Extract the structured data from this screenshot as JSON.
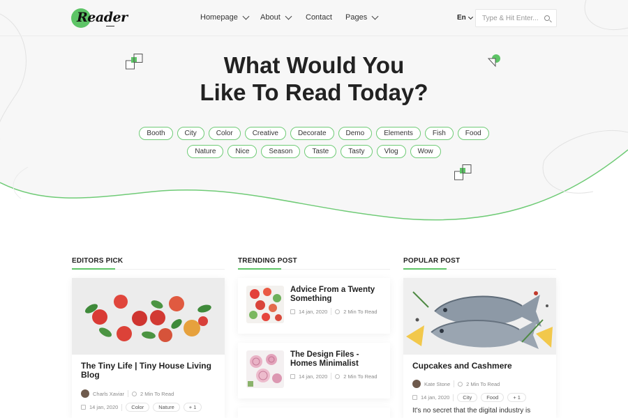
{
  "header": {
    "logo_text": "Reader",
    "nav": [
      {
        "label": "Homepage",
        "has_dropdown": true
      },
      {
        "label": "About",
        "has_dropdown": true
      },
      {
        "label": "Contact",
        "has_dropdown": false
      },
      {
        "label": "Pages",
        "has_dropdown": true
      }
    ],
    "language": "En",
    "search_placeholder": "Type & Hit Enter..."
  },
  "hero": {
    "title_line1": "What Would You",
    "title_line2": "Like To Read Today?",
    "tags_row1": [
      "Booth",
      "City",
      "Color",
      "Creative",
      "Decorate",
      "Demo",
      "Elements",
      "Fish",
      "Food"
    ],
    "tags_row2": [
      "Nature",
      "Nice",
      "Season",
      "Taste",
      "Tasty",
      "Vlog",
      "Wow"
    ]
  },
  "colors": {
    "accent": "#5dc466",
    "text": "#222222"
  },
  "editors_pick": {
    "heading": "EDITORS PICK",
    "title": "The Tiny Life | Tiny House Living Blog",
    "author": "Charls Xaviar",
    "read_time": "2 Min To Read",
    "date": "14 jan, 2020",
    "tags": [
      "Color",
      "Nature",
      "+ 1"
    ]
  },
  "trending": {
    "heading": "TRENDING POST",
    "posts": [
      {
        "title": "Advice From a Twenty Something",
        "date": "14 jan, 2020",
        "read_time": "2 Min To Read"
      },
      {
        "title": "The Design Files - Homes Minimalist",
        "date": "14 jan, 2020",
        "read_time": "2 Min To Read"
      }
    ]
  },
  "popular": {
    "heading": "POPULAR POST",
    "title": "Cupcakes and Cashmere",
    "author": "Kate Stone",
    "read_time": "2 Min To Read",
    "date": "14 jan, 2020",
    "tags": [
      "City",
      "Food",
      "+ 1"
    ],
    "excerpt": "It's no secret that the digital industry is"
  },
  "icons": [
    "chevron-down-icon",
    "search-icon",
    "calendar-icon",
    "clock-icon",
    "avatar"
  ]
}
